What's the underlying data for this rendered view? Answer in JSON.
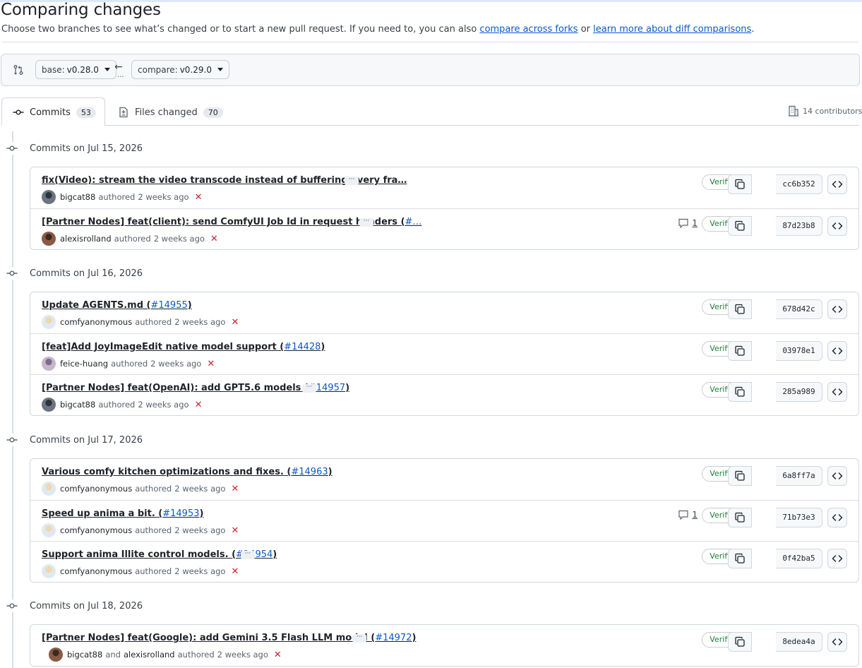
{
  "page": {
    "title": "Comparing changes",
    "subtitle_prefix": "Choose two branches to see what’s changed or to start a new pull request. If you need to, you can also ",
    "link_forks": "compare across forks",
    "subtitle_or": " or ",
    "link_learn": "learn more about diff comparisons",
    "subtitle_suffix": "."
  },
  "range": {
    "base_label": "base:",
    "base_value": "v0.28.0",
    "compare_label": "compare:",
    "compare_value": "v0.29.0",
    "dots": "..."
  },
  "tabs": {
    "commits_label": "Commits",
    "commits_count": "53",
    "files_label": "Files changed",
    "files_count": "70",
    "contributors": "14 contributors"
  },
  "labels": {
    "verified": "Verified",
    "authored": "authored",
    "and": "and"
  },
  "colors": {
    "verified_green": "#1a7f37",
    "link_blue": "#0b58c6",
    "x_red": "#cf222e"
  },
  "days": [
    {
      "heading": "Commits on Jul 15, 2026",
      "commits": [
        {
          "message": "fix(Video): stream the video transcode instead of buffering every fra…",
          "pr": "",
          "pr_suffix": "",
          "has_ellipsis": true,
          "authors": [
            "bigcat88"
          ],
          "time": "2 weeks ago",
          "comments": "",
          "sha": "cc6b352"
        },
        {
          "message": "[Partner Nodes] feat(client): send ComfyUI Job Id in request headers (",
          "pr": "#…",
          "pr_suffix": "",
          "has_ellipsis": true,
          "authors": [
            "alexisrolland"
          ],
          "time": "2 weeks ago",
          "comments": "1",
          "sha": "87d23b8"
        }
      ]
    },
    {
      "heading": "Commits on Jul 16, 2026",
      "commits": [
        {
          "message": "Update AGENTS.md (",
          "pr": "#14955",
          "pr_suffix": ")",
          "has_ellipsis": false,
          "authors": [
            "comfyanonymous"
          ],
          "time": "2 weeks ago",
          "comments": "",
          "sha": "678d42c"
        },
        {
          "message": "[feat]Add JoyImageEdit native model support (",
          "pr": "#14428",
          "pr_suffix": ")",
          "has_ellipsis": false,
          "authors": [
            "feice-huang"
          ],
          "time": "2 weeks ago",
          "comments": "",
          "sha": "03978e1"
        },
        {
          "message": "[Partner Nodes] feat(OpenAI): add GPT5.6 models (",
          "pr": "#14957",
          "pr_suffix": ")",
          "has_ellipsis": true,
          "authors": [
            "bigcat88"
          ],
          "time": "2 weeks ago",
          "comments": "",
          "sha": "285a989"
        }
      ]
    },
    {
      "heading": "Commits on Jul 17, 2026",
      "commits": [
        {
          "message": "Various comfy kitchen optimizations and fixes. (",
          "pr": "#14963",
          "pr_suffix": ")",
          "has_ellipsis": false,
          "authors": [
            "comfyanonymous"
          ],
          "time": "2 weeks ago",
          "comments": "",
          "sha": "6a8ff7a"
        },
        {
          "message": "Speed up anima a bit. (",
          "pr": "#14953",
          "pr_suffix": ")",
          "has_ellipsis": false,
          "authors": [
            "comfyanonymous"
          ],
          "time": "2 weeks ago",
          "comments": "1",
          "sha": "71b73e3"
        },
        {
          "message": "Support anima Illite control models. (",
          "pr": "#14954",
          "pr_suffix": ")",
          "has_ellipsis": true,
          "authors": [
            "comfyanonymous"
          ],
          "time": "2 weeks ago",
          "comments": "",
          "sha": "0f42ba5"
        }
      ]
    },
    {
      "heading": "Commits on Jul 18, 2026",
      "commits": [
        {
          "message": "[Partner Nodes] feat(Google): add Gemini 3.5 Flash LLM model (",
          "pr": "#14972",
          "pr_suffix": ")",
          "has_ellipsis": true,
          "authors": [
            "bigcat88",
            "alexisrolland"
          ],
          "time": "2 weeks ago",
          "comments": "",
          "sha": "8edea4a"
        }
      ]
    }
  ]
}
